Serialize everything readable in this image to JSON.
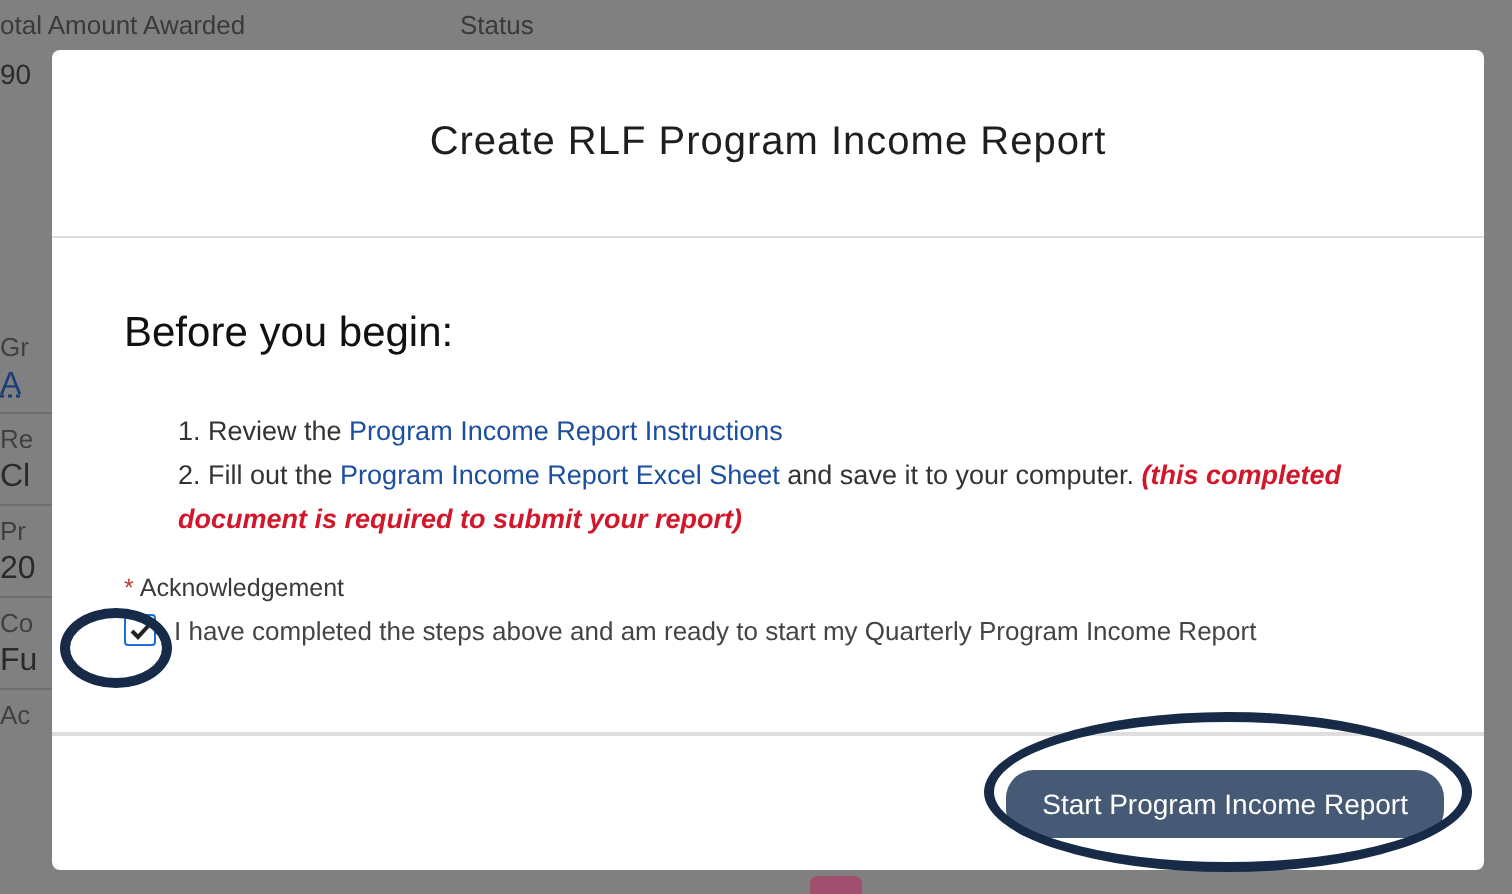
{
  "background_page": {
    "columns": [
      "otal Amount Awarded",
      "Status"
    ],
    "row_value": "90",
    "fields": [
      {
        "label": "Gr",
        "value": "A",
        "link": true
      },
      {
        "label": "Re",
        "value": "Cl",
        "link": false
      },
      {
        "label": "Pr",
        "value": "20",
        "link": false
      },
      {
        "label": "Co",
        "value": "Fu",
        "link": false
      },
      {
        "label": "Ac"
      }
    ]
  },
  "modal": {
    "title": "Create RLF Program Income Report",
    "heading": "Before you begin:",
    "steps": [
      {
        "number": "1.",
        "text": "Review the ",
        "link": "Program Income Report Instructions"
      },
      {
        "number": "2.",
        "text": "Fill out the ",
        "link": "Program Income Report Excel Sheet",
        "after": " and save it to your computer. ",
        "note": "(this completed document is required to submit your report)"
      }
    ],
    "acknowledgement": {
      "required_mark": "*",
      "label": "Acknowledgement",
      "checked": true,
      "text": "I have completed the steps above and am ready to start my Quarterly Program Income Report"
    },
    "button": "Start Program Income Report"
  }
}
